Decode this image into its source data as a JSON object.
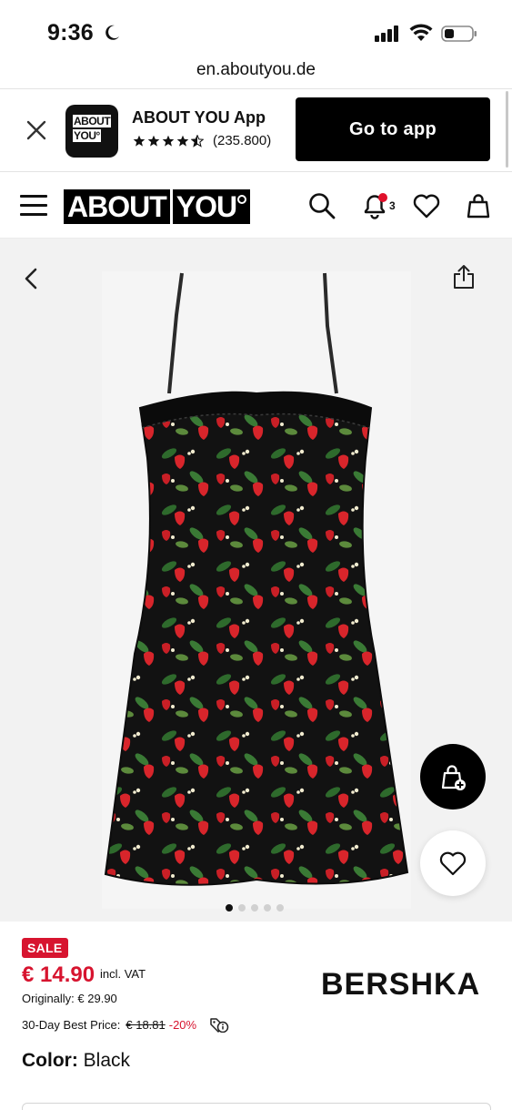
{
  "status_bar": {
    "time": "9:36"
  },
  "browser": {
    "url": "en.aboutyou.de"
  },
  "app_banner": {
    "app_name": "ABOUT YOU App",
    "logo_line1": "ABOUT",
    "logo_line2": "YOU°",
    "rating_count": "(235.800)",
    "rating_stars": 4.5,
    "cta_label": "Go to app"
  },
  "header": {
    "logo_part1": "ABOUT",
    "logo_part2": "YOU",
    "notification_count": "3"
  },
  "gallery": {
    "image_count": 5,
    "active_index": 0
  },
  "product": {
    "badge": "SALE",
    "price": "€ 14.90",
    "vat_note": "incl. VAT",
    "original_price": "Originally: € 29.90",
    "best_price_label": "30-Day Best Price:",
    "best_price_value": "€ 18.81",
    "best_price_discount": "-20%",
    "brand": "BERSHKA",
    "color_label": "Color:",
    "color_value": "Black"
  },
  "colors": {
    "sale_red": "#d7142f",
    "black": "#000000",
    "gallery_bg": "#f2f2f2"
  }
}
